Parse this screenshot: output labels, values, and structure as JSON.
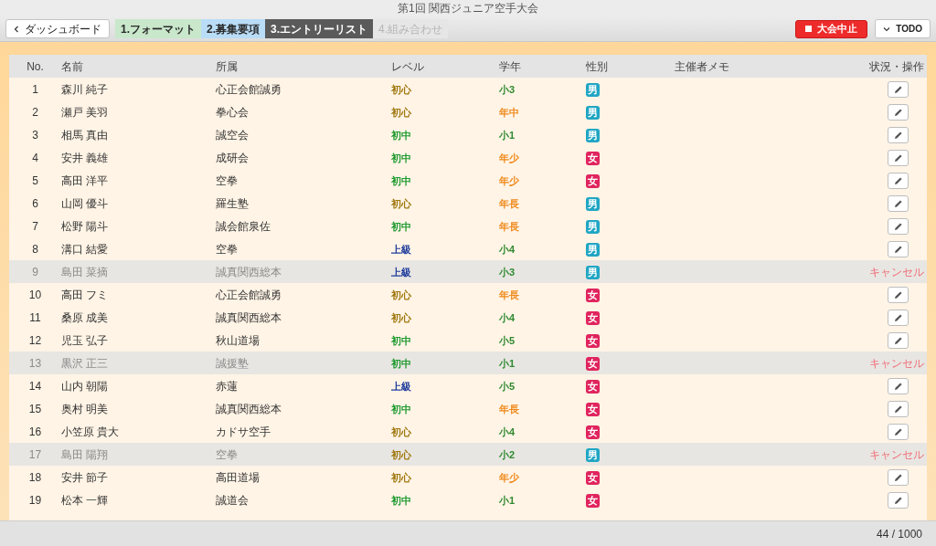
{
  "window": {
    "title": "第1回 関西ジュニア空手大会"
  },
  "toolbar": {
    "back_button": "ダッシュボード",
    "steps": [
      {
        "label": "1.フォーマット",
        "selected": false,
        "disabled": false,
        "color": "#c9e7cb"
      },
      {
        "label": "2.募集要項",
        "selected": false,
        "disabled": false,
        "color": "#b9dcf7"
      },
      {
        "label": "3.エントリーリスト",
        "selected": true,
        "disabled": false,
        "color": "#5a5a5a"
      },
      {
        "label": "4.組み合わせ",
        "selected": false,
        "disabled": true,
        "color": "#e6e6e6"
      }
    ],
    "stop_button": "大会中止",
    "todo_button": "TODO"
  },
  "table": {
    "columns": [
      "No.",
      "名前",
      "所属",
      "レベル",
      "学年",
      "性別",
      "主催者メモ",
      "状況・操作"
    ],
    "rows": [
      {
        "no": "1",
        "name": "森川 純子",
        "club": "心正会館誠勇",
        "level": {
          "text": "初心",
          "color": "#a0780f"
        },
        "grade": {
          "text": "小3",
          "color": "#2f8a2f"
        },
        "gender": {
          "text": "男",
          "color": "#20a6c4"
        },
        "cancelled": false
      },
      {
        "no": "2",
        "name": "瀬戸 美羽",
        "club": "拳心会",
        "level": {
          "text": "初心",
          "color": "#a0780f"
        },
        "grade": {
          "text": "年中",
          "color": "#f08a1c"
        },
        "gender": {
          "text": "男",
          "color": "#20a6c4"
        },
        "cancelled": false
      },
      {
        "no": "3",
        "name": "相馬 真由",
        "club": "誠空会",
        "level": {
          "text": "初中",
          "color": "#1e9a2e"
        },
        "grade": {
          "text": "小1",
          "color": "#2f8a2f"
        },
        "gender": {
          "text": "男",
          "color": "#20a6c4"
        },
        "cancelled": false
      },
      {
        "no": "4",
        "name": "安井 義雄",
        "club": "成研会",
        "level": {
          "text": "初中",
          "color": "#1e9a2e"
        },
        "grade": {
          "text": "年少",
          "color": "#f08a1c"
        },
        "gender": {
          "text": "女",
          "color": "#e0245e"
        },
        "cancelled": false
      },
      {
        "no": "5",
        "name": "高田 洋平",
        "club": "空拳",
        "level": {
          "text": "初中",
          "color": "#1e9a2e"
        },
        "grade": {
          "text": "年少",
          "color": "#f08a1c"
        },
        "gender": {
          "text": "女",
          "color": "#e0245e"
        },
        "cancelled": false
      },
      {
        "no": "6",
        "name": "山岡 優斗",
        "club": "羅生塾",
        "level": {
          "text": "初心",
          "color": "#a0780f"
        },
        "grade": {
          "text": "年長",
          "color": "#f08a1c"
        },
        "gender": {
          "text": "男",
          "color": "#20a6c4"
        },
        "cancelled": false
      },
      {
        "no": "7",
        "name": "松野 陽斗",
        "club": "誠会館泉佐",
        "level": {
          "text": "初中",
          "color": "#1e9a2e"
        },
        "grade": {
          "text": "年長",
          "color": "#f08a1c"
        },
        "gender": {
          "text": "男",
          "color": "#20a6c4"
        },
        "cancelled": false
      },
      {
        "no": "8",
        "name": "溝口 結愛",
        "club": "空拳",
        "level": {
          "text": "上級",
          "color": "#1f3c9c"
        },
        "grade": {
          "text": "小4",
          "color": "#2f8a2f"
        },
        "gender": {
          "text": "男",
          "color": "#20a6c4"
        },
        "cancelled": false
      },
      {
        "no": "9",
        "name": "島田 菜摘",
        "club": "誠真関西総本",
        "level": {
          "text": "上級",
          "color": "#1f3c9c"
        },
        "grade": {
          "text": "小3",
          "color": "#2f8a2f"
        },
        "gender": {
          "text": "男",
          "color": "#20a6c4"
        },
        "cancelled": true,
        "status": "キャンセル"
      },
      {
        "no": "10",
        "name": "高田 フミ",
        "club": "心正会館誠勇",
        "level": {
          "text": "初心",
          "color": "#a0780f"
        },
        "grade": {
          "text": "年長",
          "color": "#f08a1c"
        },
        "gender": {
          "text": "女",
          "color": "#e0245e"
        },
        "cancelled": false
      },
      {
        "no": "11",
        "name": "桑原 成美",
        "club": "誠真関西総本",
        "level": {
          "text": "初心",
          "color": "#a0780f"
        },
        "grade": {
          "text": "小4",
          "color": "#2f8a2f"
        },
        "gender": {
          "text": "女",
          "color": "#e0245e"
        },
        "cancelled": false
      },
      {
        "no": "12",
        "name": "児玉 弘子",
        "club": "秋山道場",
        "level": {
          "text": "初中",
          "color": "#1e9a2e"
        },
        "grade": {
          "text": "小5",
          "color": "#2f8a2f"
        },
        "gender": {
          "text": "女",
          "color": "#e0245e"
        },
        "cancelled": false
      },
      {
        "no": "13",
        "name": "黒沢 正三",
        "club": "誠援塾",
        "level": {
          "text": "初中",
          "color": "#1e9a2e"
        },
        "grade": {
          "text": "小1",
          "color": "#2f8a2f"
        },
        "gender": {
          "text": "女",
          "color": "#e0245e"
        },
        "cancelled": true,
        "status": "キャンセル"
      },
      {
        "no": "14",
        "name": "山内 朝陽",
        "club": "赤蓮",
        "level": {
          "text": "上級",
          "color": "#1f3c9c"
        },
        "grade": {
          "text": "小5",
          "color": "#2f8a2f"
        },
        "gender": {
          "text": "女",
          "color": "#e0245e"
        },
        "cancelled": false
      },
      {
        "no": "15",
        "name": "奥村 明美",
        "club": "誠真関西総本",
        "level": {
          "text": "初中",
          "color": "#1e9a2e"
        },
        "grade": {
          "text": "年長",
          "color": "#f08a1c"
        },
        "gender": {
          "text": "女",
          "color": "#e0245e"
        },
        "cancelled": false
      },
      {
        "no": "16",
        "name": "小笠原 貴大",
        "club": "カドサ空手",
        "level": {
          "text": "初心",
          "color": "#a0780f"
        },
        "grade": {
          "text": "小4",
          "color": "#2f8a2f"
        },
        "gender": {
          "text": "女",
          "color": "#e0245e"
        },
        "cancelled": false
      },
      {
        "no": "17",
        "name": "島田 陽翔",
        "club": "空拳",
        "level": {
          "text": "初心",
          "color": "#a0780f"
        },
        "grade": {
          "text": "小2",
          "color": "#2f8a2f"
        },
        "gender": {
          "text": "男",
          "color": "#20a6c4"
        },
        "cancelled": true,
        "status": "キャンセル"
      },
      {
        "no": "18",
        "name": "安井 節子",
        "club": "高田道場",
        "level": {
          "text": "初心",
          "color": "#a0780f"
        },
        "grade": {
          "text": "年少",
          "color": "#f08a1c"
        },
        "gender": {
          "text": "女",
          "color": "#e0245e"
        },
        "cancelled": false
      },
      {
        "no": "19",
        "name": "松本 一輝",
        "club": "誠道会",
        "level": {
          "text": "初中",
          "color": "#1e9a2e"
        },
        "grade": {
          "text": "小1",
          "color": "#2f8a2f"
        },
        "gender": {
          "text": "女",
          "color": "#e0245e"
        },
        "cancelled": false
      }
    ]
  },
  "status_bar": {
    "count": "44 / 1000"
  }
}
